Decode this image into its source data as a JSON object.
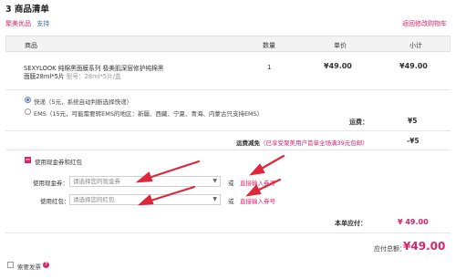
{
  "page": {
    "title": "3 商品清单",
    "store_label": "聚美优品",
    "store_link": "支持",
    "back_link": "返回修改购物车"
  },
  "table": {
    "headers": [
      "商品",
      "数量",
      "单价",
      "小计"
    ],
    "item": {
      "name_line1": "SEXYLOOK 纯棉黑面膜系列 极美肌深层修护纯棉黑",
      "name_line2": "面膜28ml*5片",
      "spec": "型号：28ml*5片/盒",
      "quantity": "1",
      "unit_price": "¥49.00",
      "subtotal": "¥49.00"
    }
  },
  "shipping": {
    "option1": "快递（5元，系统自动判断选择快递）",
    "option2": "EMS（15元，可能需要转EMS的地区：新疆、西藏、宁夏、青海、内蒙古只支持EMS）",
    "freight_label": "运费：",
    "freight_value": "¥5",
    "discount_label": "运费减免",
    "discount_note": "（已享受聚美用户首单全场满39元包邮）",
    "discount_value": "-¥5"
  },
  "coupons": {
    "toggle_label": "使用现金券和红包",
    "cash_label": "使用现金券：",
    "cash_placeholder": "请选择您的现金券",
    "or1": "或",
    "cash_link": "直接输入券号",
    "red_label": "使用红包：",
    "red_placeholder": "请选择您的红包",
    "or2": "或",
    "red_link": "直接输入券号"
  },
  "totals": {
    "order_due_label": "本单应付：",
    "order_due_value": "¥ 49.00",
    "total_due_label": "应付总额：",
    "total_due_value": "¥49.00"
  },
  "invoice": {
    "label": "索要发票",
    "help_icon": "?"
  },
  "colors": {
    "accent": "#d6246b",
    "link_blue": "#3a6fb0",
    "arrow_red": "#e0263a",
    "header_bg": "#f3f3f3"
  }
}
